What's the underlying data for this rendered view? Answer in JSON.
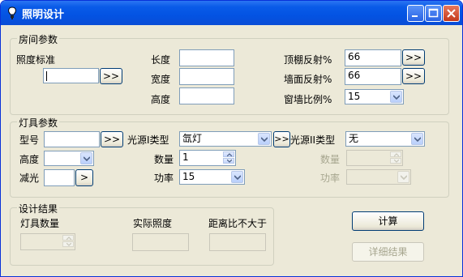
{
  "window": {
    "title": "照明设计"
  },
  "room": {
    "legend": "房间参数",
    "illum_std_label": "照度标准",
    "illum_std_value": "",
    "length_label": "长度",
    "width_label": "宽度",
    "height_label": "高度",
    "ceiling_label": "顶棚反射%",
    "ceiling_value": "66",
    "wall_label": "墙面反射%",
    "wall_value": "66",
    "window_wall_label": "窗墙比例%",
    "window_wall_value": "15",
    "more_label": ">>"
  },
  "lamp": {
    "legend": "灯具参数",
    "model_label": "型号",
    "model_value": "",
    "height_label": "高度",
    "reduce_label": "减光",
    "more_label": ">>",
    "small_more_label": ">",
    "src1_label": "光源I类型",
    "src1_value": "氙灯",
    "count1_label": "数量",
    "count1_value": "1",
    "power1_label": "功率",
    "power1_value": "15",
    "src2_label": "光源II类型",
    "src2_value": "无",
    "count2_label": "数量",
    "power2_label": "功率"
  },
  "result": {
    "legend": "设计结果",
    "lamp_count_label": "灯具数量",
    "actual_illum_label": "实际照度",
    "distance_ratio_label": "距离比不大于"
  },
  "buttons": {
    "calc": "计算",
    "detail": "详细结果"
  },
  "colors": {
    "titlebar": "#0a5be8",
    "background": "#ece9d8",
    "border": "#7f9db9"
  }
}
